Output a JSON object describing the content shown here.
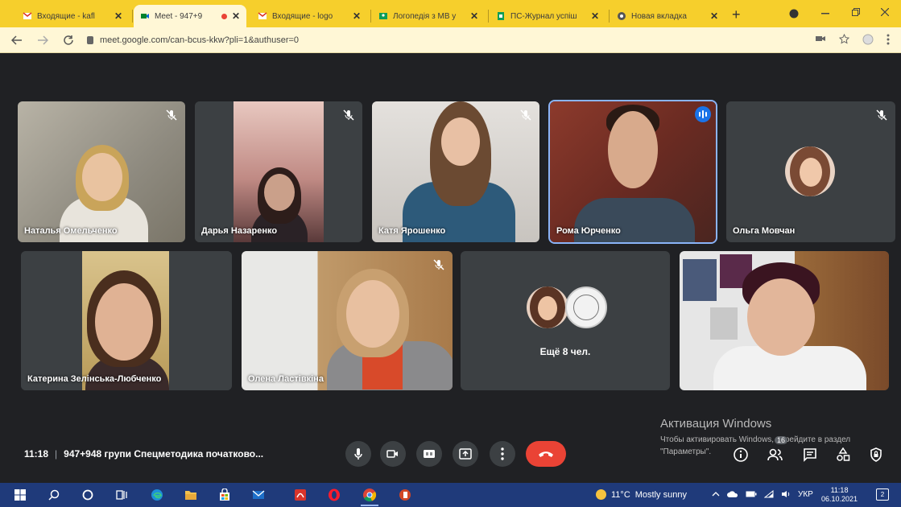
{
  "browser": {
    "tabs": [
      {
        "title": "Входящие - kafl",
        "favicon": "gmail-icon",
        "active": false
      },
      {
        "title": "Meet - 947+9",
        "favicon": "meet-icon",
        "active": true
      },
      {
        "title": "Входящие - logo",
        "favicon": "gmail-icon",
        "active": false
      },
      {
        "title": "Логопедія з МВ у",
        "favicon": "classroom-icon",
        "active": false
      },
      {
        "title": "ПС-Журнал успіш",
        "favicon": "sheets-icon",
        "active": false
      },
      {
        "title": "Новая вкладка",
        "favicon": "chrome-icon",
        "active": false
      }
    ],
    "close_glyph": "✕",
    "new_tab_glyph": "+",
    "url": "meet.google.com/can-bcus-kkw?pli=1&authuser=0"
  },
  "meet": {
    "participants": [
      {
        "name": "Наталья Омельченко",
        "muted": true,
        "speaking": false
      },
      {
        "name": "Дарья Назаренко",
        "muted": true,
        "speaking": false
      },
      {
        "name": "Катя Ярошенко",
        "muted": true,
        "speaking": false
      },
      {
        "name": "Рома Юрченко",
        "muted": false,
        "speaking": true
      },
      {
        "name": "Ольга Мовчан",
        "muted": true,
        "speaking": false
      },
      {
        "name": "Катерина Зелінська-Любченко",
        "muted": false,
        "speaking": false
      },
      {
        "name": "Олена Ластівкіна",
        "muted": true,
        "speaking": false
      },
      {
        "name": "",
        "muted": false,
        "speaking": false
      }
    ],
    "more_participants": "Ещё 8 чел.",
    "clock": "11:18",
    "meeting_title": "947+948 групи Спецметодика початково...",
    "controls": [
      "microphone",
      "camera",
      "captions",
      "present",
      "more-options",
      "leave-call"
    ],
    "side_controls": [
      "meeting-details",
      "people",
      "chat",
      "activities",
      "host-controls"
    ],
    "people_badge": "16"
  },
  "windows_activation": {
    "title": "Активация Windows",
    "text": "Чтобы активировать Windows, перейдите в раздел \"Параметры\"."
  },
  "taskbar": {
    "weather_temp": "11°C",
    "weather_text": "Mostly sunny",
    "language": "УКР",
    "time": "11:18",
    "date": "06.10.2021",
    "notifications": "2"
  },
  "colors": {
    "chrome_tab_bar": "#f6cf2c",
    "meet_background": "#202124",
    "tile_background": "#3c4043",
    "leave_button": "#ea4335",
    "speaking_outline": "#8ab4f8",
    "taskbar": "#1f3a7a"
  }
}
